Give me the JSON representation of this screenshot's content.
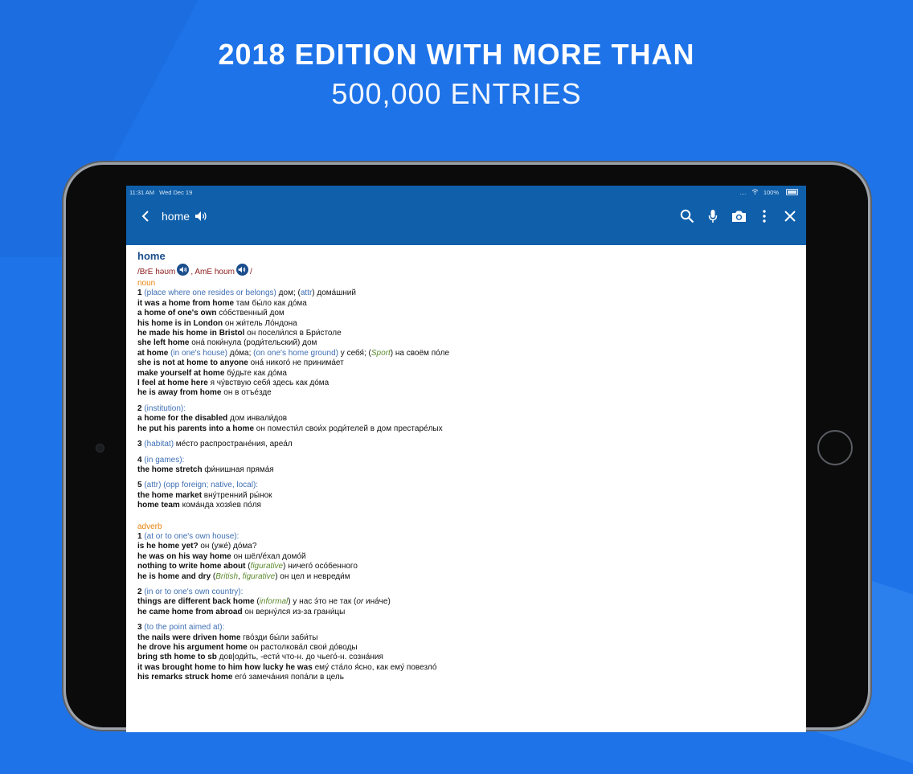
{
  "headline": {
    "line1": "2018 EDITION WITH MORE THAN",
    "line2": "500,000 ENTRIES"
  },
  "status": {
    "time": "11:31 AM",
    "date": "Wed Dec 19",
    "dots": "....",
    "battery": "100%"
  },
  "toolbar": {
    "word": "home",
    "icons": [
      "back-icon",
      "speaker-icon",
      "search-icon",
      "microphone-icon",
      "camera-icon",
      "more-icon",
      "close-icon"
    ]
  },
  "entry": {
    "headword": "home",
    "pron": {
      "bre_prefix": "/BrE ",
      "bre": "həʊm",
      "sep": ", AmE ",
      "ame": "hoʊm",
      "end": "/"
    },
    "noun": {
      "pos": "noun",
      "s1": {
        "num": "1",
        "label": "(place where one resides or belongs)",
        "tr": " дом; (",
        "attr": "attr",
        "tr2": ") дома́шний",
        "ex": [
          {
            "en": "it was a home from home",
            "ru": " там бы́ло как до́ма"
          },
          {
            "en": "a home of one's own",
            "ru": " со́бственный дом"
          },
          {
            "en": "his home is in London",
            "ru": " он жи́тель Ло́ндона"
          },
          {
            "en": "he made his home in Bristol",
            "ru": " он посели́лся в Бри́столе"
          },
          {
            "en": "she left home",
            "ru": " она́ поки́нула (роди́тельский) дом"
          }
        ],
        "athome": {
          "en": "at home",
          "lab1": " (in one's house)",
          "t1": " до́ма; ",
          "lab2": "(on one's home ground)",
          "t2": " у себя́; (",
          "sport": "Sport",
          "t3": ") на своём по́ле"
        },
        "ex2": [
          {
            "en": "she is not at home to anyone",
            "ru": " она́ никого́ не принима́ет"
          },
          {
            "en": "make yourself at home",
            "ru": " бу́дьте как до́ма"
          },
          {
            "en": "I feel at home here",
            "ru": " я чу́вствую себя́ здесь как до́ма"
          },
          {
            "en": "he is away from home",
            "ru": " он в отъе́зде"
          }
        ]
      },
      "s2": {
        "num": "2",
        "label": " (institution):",
        "ex": [
          {
            "en": "a home for the disabled",
            "ru": " дом инвали́дов"
          },
          {
            "en": "he put his parents into a home",
            "ru": " он помести́л свои́х роди́телей в дом престаре́лых"
          }
        ]
      },
      "s3": {
        "num": "3",
        "label": " (habitat)",
        "tr": " ме́сто распростране́ния, ареа́л"
      },
      "s4": {
        "num": "4",
        "label": " (in games):",
        "ex": [
          {
            "en": "the home stretch",
            "ru": " фи́нишная пряма́я"
          }
        ]
      },
      "s5": {
        "num": "5",
        "attr": " (attr)",
        "label": " (opp foreign; native, local):",
        "ex": [
          {
            "en": "the home market",
            "ru": " вну́тренний ры́нок"
          },
          {
            "en": "home team",
            "ru": " кома́нда хозя́ев по́ля"
          }
        ]
      }
    },
    "adverb": {
      "pos": "adverb",
      "s1": {
        "num": "1",
        "label": " (at or to one's own house):",
        "ex": [
          {
            "en": "is he home yet?",
            "ru": " он (уже́) до́ма?"
          },
          {
            "en": "he was on his way home",
            "ru": " он шёл/е́хал домо́й"
          }
        ],
        "ex3": {
          "en": "nothing to write home about",
          "p1": " (",
          "it": "figurative",
          "p2": ") ничего́ осо́бенного"
        },
        "ex4": {
          "en": "he is home and dry",
          "p1": " (",
          "it1": "British",
          "c": ", ",
          "it2": "figurative",
          "p2": ") он цел и невреди́м"
        }
      },
      "s2": {
        "num": "2",
        "label": " (in or to one's own country):",
        "ex1": {
          "en": "things are different back home",
          "p1": " (",
          "it": "informal",
          "p2": ") у нас э́то не так (",
          "or": "or",
          "p3": " ина́че)"
        },
        "ex2": {
          "en": "he came home from abroad",
          "ru": " он верну́лся из-за грани́цы"
        }
      },
      "s3": {
        "num": "3",
        "label": " (to the point aimed at):",
        "ex": [
          {
            "en": "the nails were driven home",
            "ru": " гво́зди бы́ли заби́ты"
          },
          {
            "en": "he drove his argument home",
            "ru": " он растолкова́л свои́ до́воды"
          },
          {
            "en": "bring sth home to sb",
            "ru": " дов|оди́ть, -ести́ что-н. до чьего́-н. созна́ния"
          },
          {
            "en": "it was brought home to him how lucky he was",
            "ru": " ему́ ста́ло я́сно, как ему́ повезло́"
          },
          {
            "en": "his remarks struck home",
            "ru": " его́ замеча́ния попа́ли в цель"
          }
        ]
      }
    }
  }
}
